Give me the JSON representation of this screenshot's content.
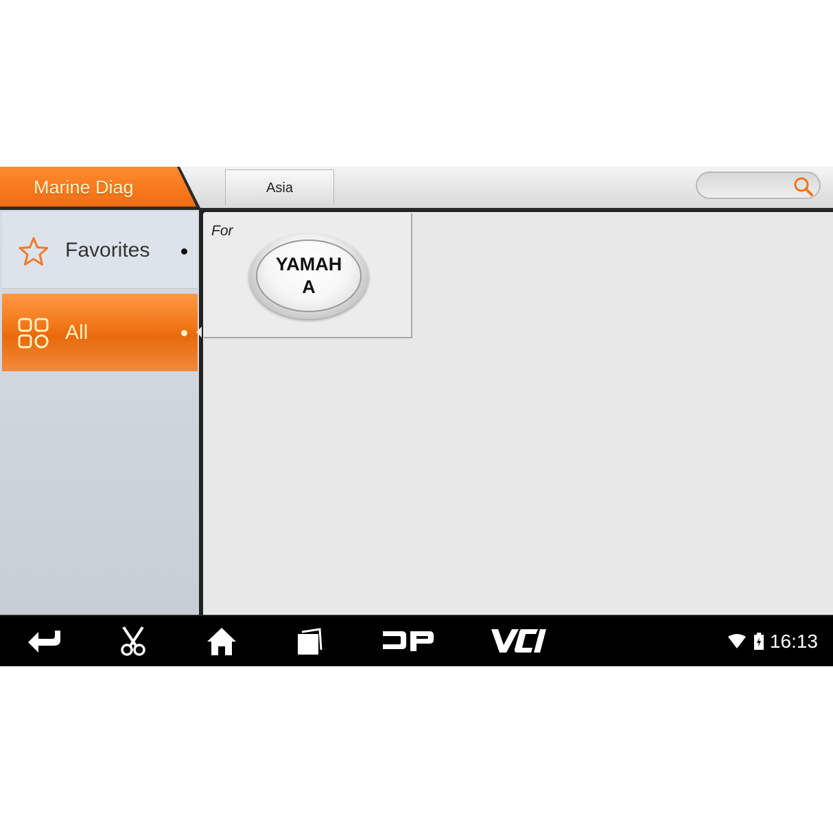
{
  "header": {
    "title": "Marine Diag",
    "region_tab": "Asia",
    "search_placeholder": ""
  },
  "sidebar": {
    "items": [
      {
        "label": "Favorites",
        "icon": "star-icon",
        "selected": false
      },
      {
        "label": "All",
        "icon": "grid-icon",
        "selected": true
      }
    ]
  },
  "brands": [
    {
      "prefix": "For",
      "name": "YAMAHA"
    }
  ],
  "navbar": {
    "buttons": [
      "back-icon",
      "scissors-icon",
      "home-icon",
      "recent-apps-icon",
      "dp-icon",
      "vci-icon"
    ],
    "dp_label": "DP",
    "vci_label": "VCI"
  },
  "status": {
    "time": "16:13",
    "icons": [
      "wifi-icon",
      "battery-icon"
    ]
  },
  "colors": {
    "accent": "#f07415",
    "accent_text": "#fff1c0",
    "navbar": "#000000"
  }
}
